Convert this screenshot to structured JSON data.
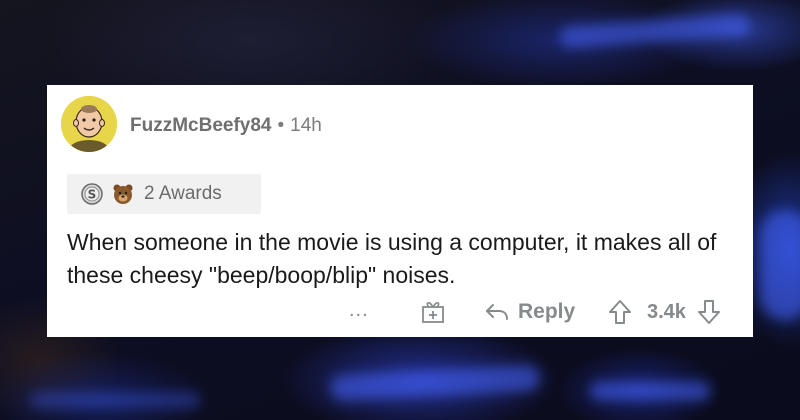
{
  "comment": {
    "username": "FuzzMcBeefy84",
    "separator": "•",
    "time_ago": "14h",
    "awards_label": "2 Awards",
    "body": "When someone in the movie is using a computer, it makes all of these cheesy \"beep/boop/blip\" noises.",
    "more_label": "...",
    "reply_label": "Reply",
    "vote_count": "3.4k"
  },
  "icons": {
    "avatar": "snoo-avatar",
    "award_1": "silver-award-icon",
    "award_2": "bear-award-icon",
    "more": "ellipsis-icon",
    "give_award": "gift-icon",
    "reply": "reply-arrow-icon",
    "upvote": "upvote-arrow-icon",
    "downvote": "downvote-arrow-icon"
  },
  "colors": {
    "card_bg": "#ffffff",
    "meta_text": "#7c7c7c",
    "action_gray": "#878a8c",
    "avatar_bg": "#e8d64a"
  }
}
